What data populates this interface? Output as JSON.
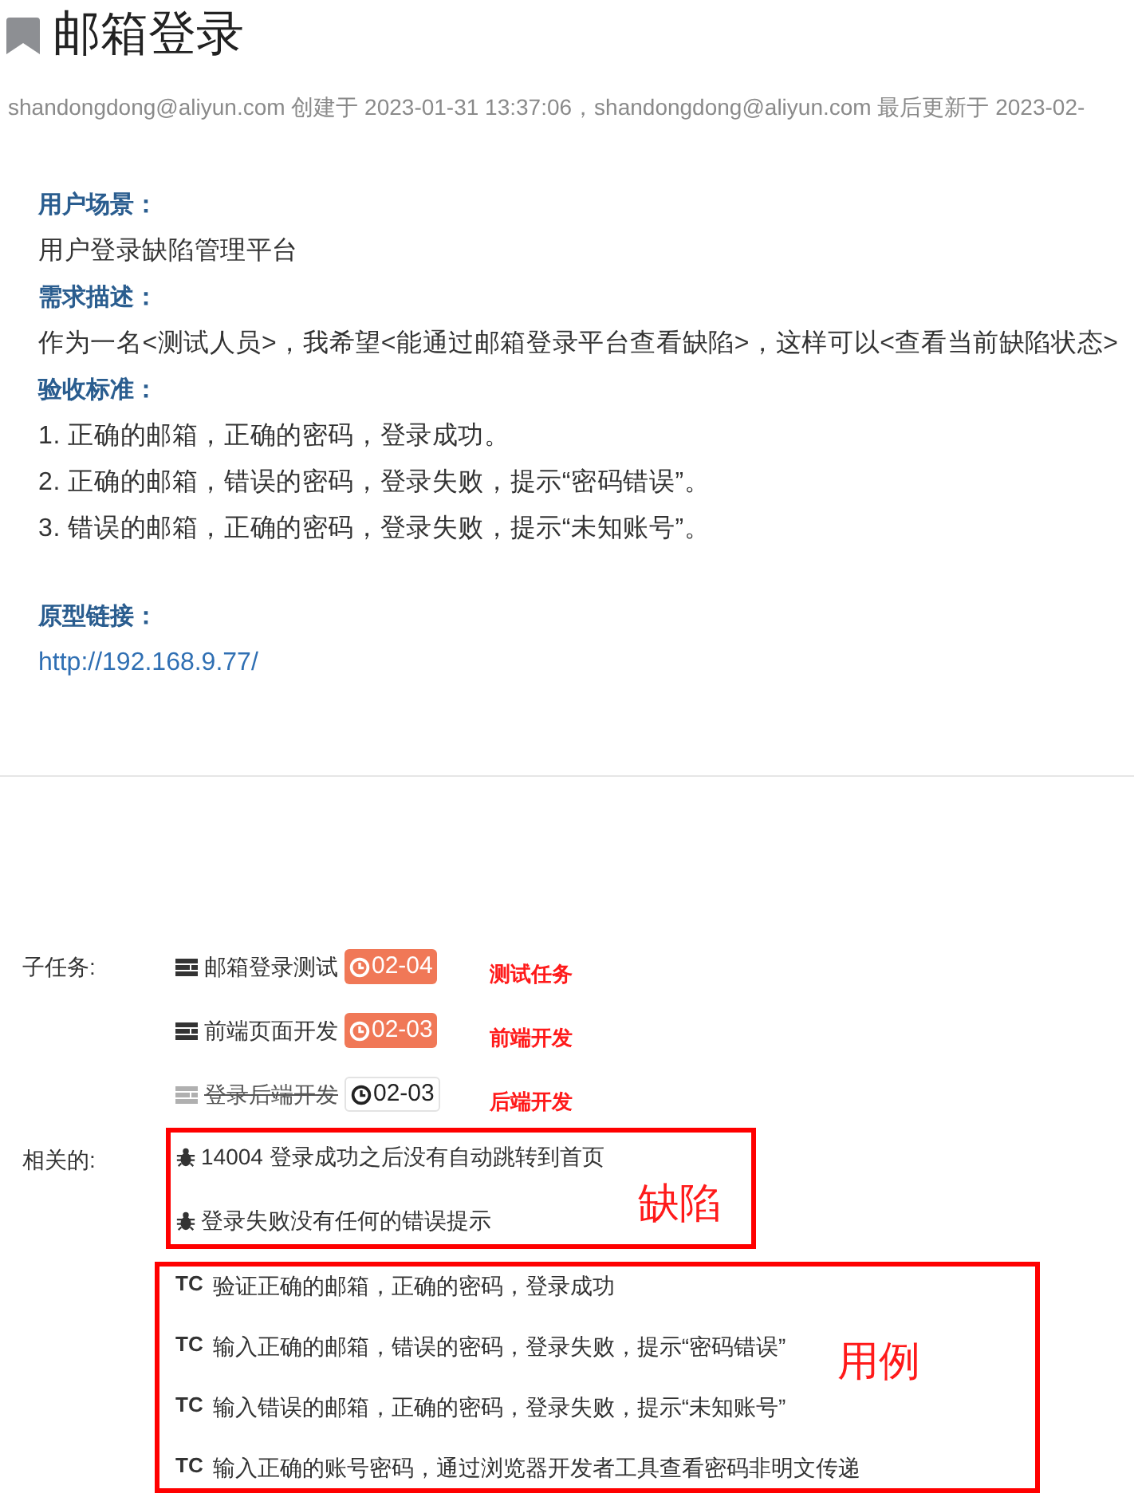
{
  "title": "邮箱登录",
  "meta": "shandongdong@aliyun.com 创建于 2023-01-31 13:37:06，shandongdong@aliyun.com 最后更新于 2023-02-",
  "description": [
    {
      "kind": "heading",
      "text": "用户场景："
    },
    {
      "kind": "text",
      "text": "用户登录缺陷管理平台"
    },
    {
      "kind": "heading",
      "text": "需求描述："
    },
    {
      "kind": "text",
      "text": "作为一名<测试人员>，我希望<能通过邮箱登录平台查看缺陷>，这样可以<查看当前缺陷状态>"
    },
    {
      "kind": "heading",
      "text": "验收标准："
    },
    {
      "kind": "text",
      "text": "1. 正确的邮箱，正确的密码，登录成功。"
    },
    {
      "kind": "text",
      "text": "2. 正确的邮箱，错误的密码，登录失败，提示“密码错误”。"
    },
    {
      "kind": "text",
      "text": "3. 错误的邮箱，正确的密码，登录失败，提示“未知账号”。"
    }
  ],
  "prototype": {
    "heading": "原型链接：",
    "link": "http://192.168.9.77/"
  },
  "subtasks": {
    "label": "子任务:",
    "items": [
      {
        "name": "邮箱登录测试",
        "due": "02-04",
        "overdue": true,
        "done": false,
        "note": "测试任务"
      },
      {
        "name": "前端页面开发",
        "due": "02-03",
        "overdue": true,
        "done": false,
        "note": "前端开发"
      },
      {
        "name": "登录后端开发",
        "due": "02-03",
        "overdue": false,
        "done": true,
        "note": "后端开发"
      }
    ]
  },
  "related": {
    "label": "相关的:",
    "bugs": {
      "note": "缺陷",
      "items": [
        {
          "text": "14004 登录成功之后没有自动跳转到首页"
        },
        {
          "text": "登录失败没有任何的错误提示"
        }
      ]
    },
    "tests": {
      "note": "用例",
      "items": [
        {
          "tag": "TC",
          "text": "验证正确的邮箱，正确的密码，登录成功"
        },
        {
          "tag": "TC",
          "text": "输入正确的邮箱，错误的密码，登录失败，提示“密码错误”"
        },
        {
          "tag": "TC",
          "text": "输入错误的邮箱，正确的密码，登录失败，提示“未知账号”"
        },
        {
          "tag": "TC",
          "text": "输入正确的账号密码，通过浏览器开发者工具查看密码非明文传递"
        }
      ]
    }
  }
}
